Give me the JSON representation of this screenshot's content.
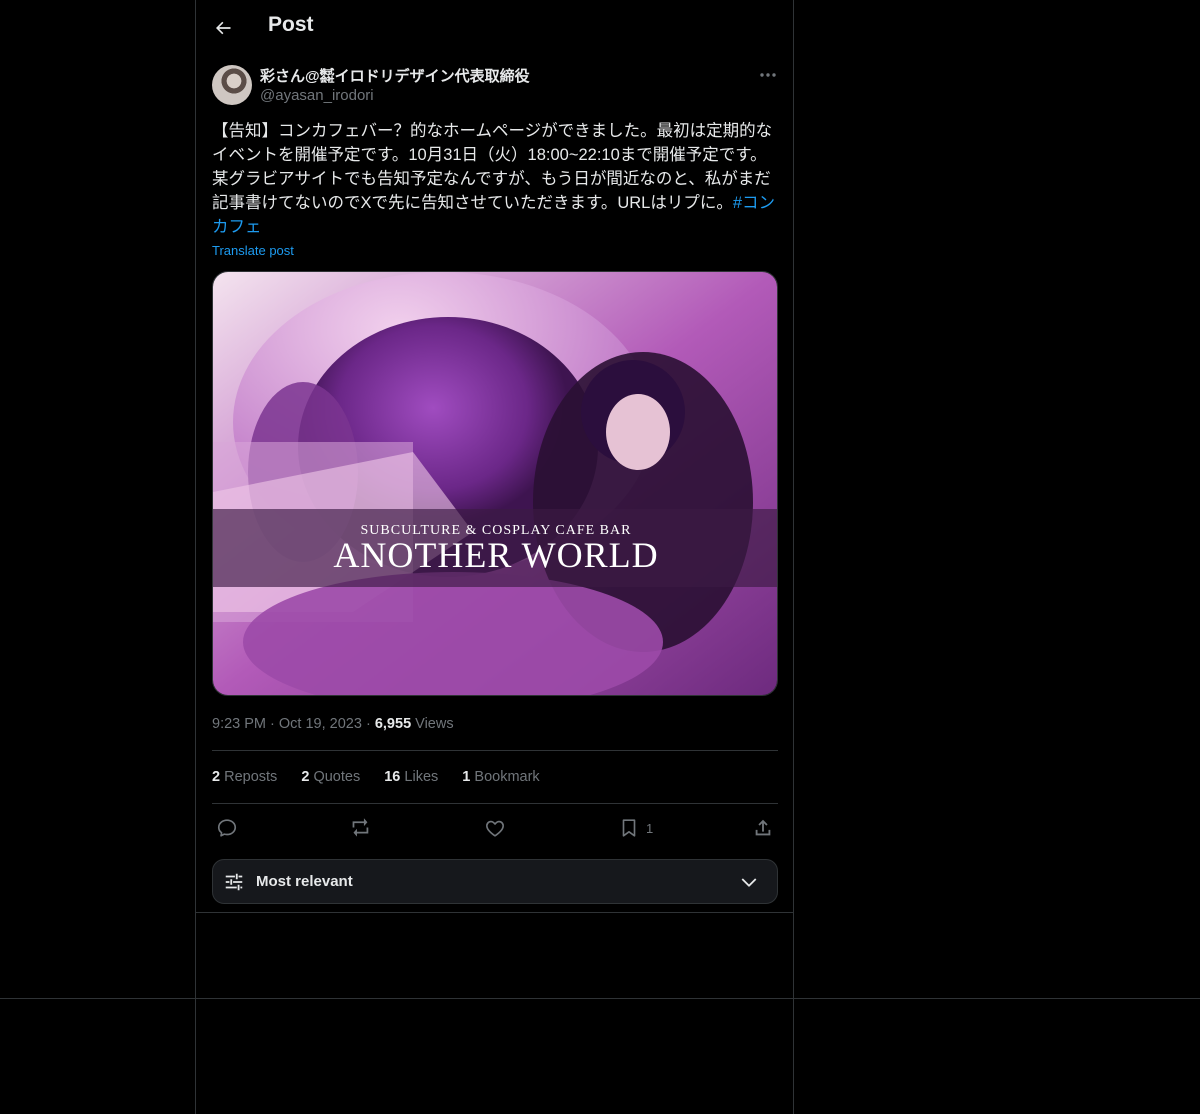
{
  "header": {
    "title": "Post",
    "back_icon": "arrow-left-icon"
  },
  "post": {
    "author": {
      "display_name": "彩さん@㍿イロドリデザイン代表取締役",
      "handle": "@ayasan_irodori"
    },
    "text": "【告知】コンカフェバー？的なホームページができました。最初は定期的なイベントを開催予定です。10月31日（火）18:00~22:10まで開催予定です。某グラビアサイトでも告知予定なんですが、もう日が間近なのと、私がまだ記事書けてないのでXで先に告知させていただきます。URLはリプに。",
    "hashtag": "#コンカフェ",
    "translate_label": "Translate post",
    "media": {
      "subtitle": "SUBCULTURE & COSPLAY CAFE BAR",
      "title": "ANOTHER WORLD"
    },
    "time": "9:23 PM",
    "date": "Oct 19, 2023",
    "views_count": "6,955",
    "views_label": "Views",
    "separator": "·"
  },
  "stats": {
    "reposts_count": "2",
    "reposts_label": "Reposts",
    "quotes_count": "2",
    "quotes_label": "Quotes",
    "likes_count": "16",
    "likes_label": "Likes",
    "bookmarks_count": "1",
    "bookmarks_label": "Bookmark"
  },
  "actions": {
    "reply_icon": "reply-icon",
    "repost_icon": "repost-icon",
    "like_icon": "heart-icon",
    "bookmark_icon": "bookmark-icon",
    "bookmark_count": "1",
    "share_icon": "share-icon"
  },
  "sort": {
    "label": "Most relevant",
    "icon": "sliders-icon",
    "chevron": "chevron-down-icon"
  },
  "colors": {
    "background": "#000000",
    "text": "#e7e9ea",
    "muted": "#71767b",
    "link": "#1d9bf0",
    "border": "#2f3336"
  }
}
